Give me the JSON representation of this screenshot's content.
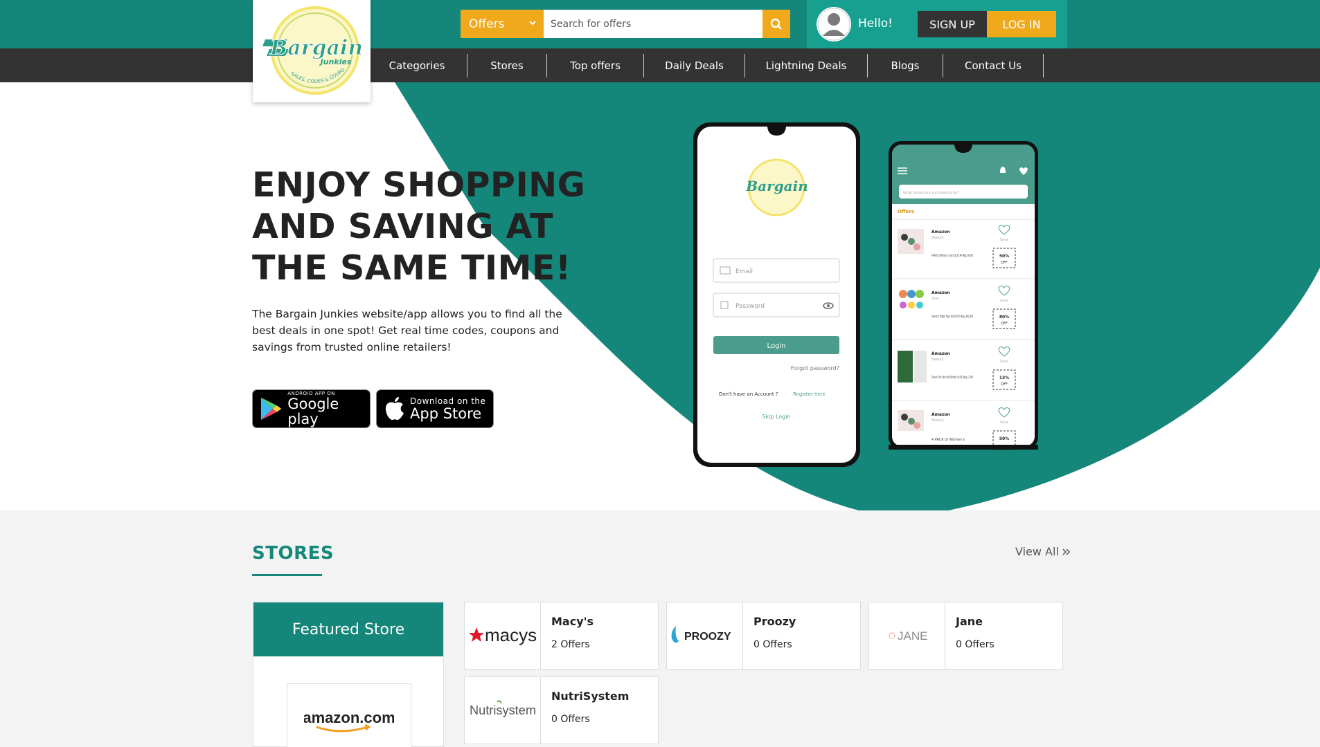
{
  "brand": {
    "logo_alt": "The Bargain Junkies",
    "logo_word": "Bargain",
    "logo_sub": "Junkies",
    "logo_tagline": "SALES, CODES & COUPONS"
  },
  "search": {
    "type_selected": "Offers",
    "placeholder": "Search for offers"
  },
  "user": {
    "greeting": "Hello!",
    "signup": "SIGN UP",
    "login": "LOG IN"
  },
  "nav": [
    {
      "label": "Categories"
    },
    {
      "label": "Stores"
    },
    {
      "label": "Top offers"
    },
    {
      "label": "Daily Deals"
    },
    {
      "label": "Lightning Deals"
    },
    {
      "label": "Blogs"
    },
    {
      "label": "Contact Us"
    }
  ],
  "hero": {
    "title": "ENJOY SHOPPING AND SAVING AT THE SAME TIME!",
    "description": "The Bargain Junkies website/app allows you to find all the best deals in one spot! Get real time codes, coupons and savings from trusted online retailers!",
    "google_play": {
      "small": "ANDROID APP ON",
      "big": "Google play"
    },
    "app_store": {
      "small": "Download on the",
      "big": "App Store"
    }
  },
  "phone_login": {
    "email": "Email",
    "password": "Password",
    "login": "Login",
    "forgot": "Forgot password?",
    "no_account": "Don't have an Account ?",
    "register": "Register here",
    "skip": "Skip Login"
  },
  "phone_offers": {
    "search_placeholder": "What stores are you looking for?",
    "section": "Offers",
    "items": [
      {
        "store": "Amazon",
        "category": "Beauty",
        "title": "4 PACK of Women's Claw Clip $3.49 (Reg. $6.99)",
        "discount": "50%",
        "off": "OFF",
        "save": "Save"
      },
      {
        "store": "Amazon",
        "category": "Toys",
        "title": "Sensory Fidget Toys Set $8.60 (Reg. $42.99)",
        "discount": "80%",
        "off": "OFF",
        "save": "Save"
      },
      {
        "store": "Amazon",
        "category": "Beauty",
        "title": "Glow in The Dark Nail Stickers $6.95 (Reg. $7.99)",
        "discount": "13%",
        "off": "OFF",
        "save": "Save"
      },
      {
        "store": "Amazon",
        "category": "Beauty",
        "title": "4 PACK of Women's",
        "discount": "50%",
        "off": "OFF",
        "save": "Save"
      }
    ]
  },
  "stores_section": {
    "title": "STORES",
    "view_all": "View All",
    "featured_label": "Featured Store",
    "featured_logo": "amazon.com",
    "stores": [
      {
        "name": "Macy's",
        "offers": "2 Offers",
        "logo_text": "macys"
      },
      {
        "name": "Proozy",
        "offers": "0 Offers",
        "logo_text": "PROOZY"
      },
      {
        "name": "Jane",
        "offers": "0 Offers",
        "logo_text": "JANE"
      },
      {
        "name": "NutriSystem",
        "offers": "0 Offers",
        "logo_text": "Nutrisystem"
      }
    ]
  },
  "colors": {
    "teal": "#14877a",
    "teal_light": "#17a090",
    "orange": "#f0a91b",
    "dark": "#333333"
  }
}
